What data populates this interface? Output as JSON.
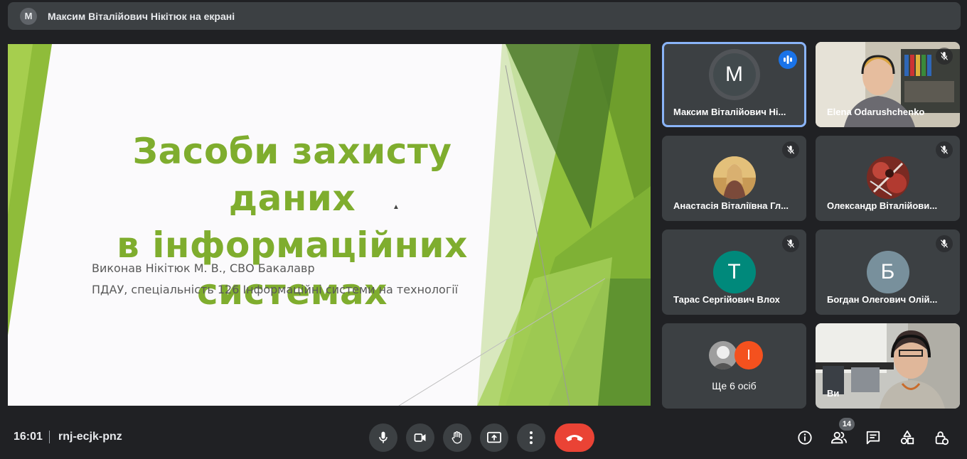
{
  "presenter_banner": {
    "avatar_letter": "M",
    "text": "Максим Віталійович Нікітюк на екрані"
  },
  "slide": {
    "title": "Засоби захисту даних\nв інформаційних\nсистемах",
    "subtitle_line1": "Виконав Нікітюк М. В., СВО Бакалавр",
    "subtitle_line2": "ПДАУ, спеціальність 126 Інформаційні системи на технології",
    "accent_color": "#7fad2e"
  },
  "participants": [
    {
      "name": "Максим Віталійович Ні...",
      "avatar_letter": "M",
      "avatar_color": "#424a4d",
      "state": "speaking",
      "highlighted": true
    },
    {
      "name": "Elena Odarushchenko",
      "state": "muted",
      "video": true
    },
    {
      "name": "Анастасія Віталіївна Гл...",
      "state": "muted",
      "photo": true
    },
    {
      "name": "Олександр Віталійови...",
      "state": "muted",
      "photo": true
    },
    {
      "name": "Тарас Сергійович Влох",
      "avatar_letter": "Т",
      "avatar_color": "#00897b",
      "state": "muted"
    },
    {
      "name": "Богдан Олегович Олій...",
      "avatar_letter": "Б",
      "avatar_color": "#78909c",
      "state": "muted"
    },
    {
      "name": "Ще 6 осіб",
      "avatar_letter": "I",
      "avatar_color": "#f4511e",
      "group": true
    },
    {
      "name": "Ви",
      "video": true,
      "self": true
    }
  ],
  "bottom_bar": {
    "time": "16:01",
    "meeting_code": "rnj-ecjk-pnz",
    "participant_count": "14",
    "controls": [
      "microphone-icon",
      "camera-icon",
      "raise-hand-icon",
      "present-screen-icon",
      "more-options-icon",
      "end-call-icon"
    ],
    "right_controls": [
      "info-icon",
      "people-icon",
      "chat-icon",
      "activities-icon",
      "host-controls-icon"
    ],
    "end_call_color": "#ea4335"
  }
}
